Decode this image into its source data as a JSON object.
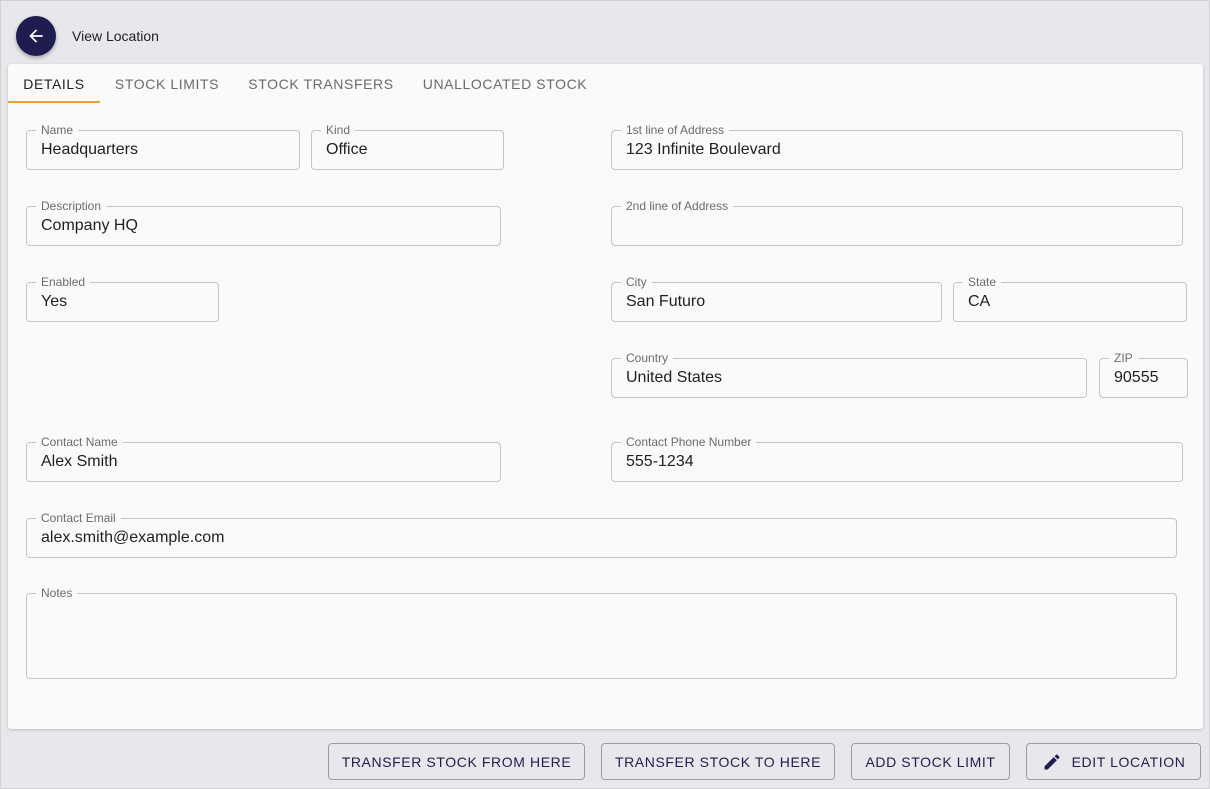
{
  "header": {
    "title": "View Location"
  },
  "tabs": [
    {
      "label": "Details",
      "active": true
    },
    {
      "label": "Stock Limits",
      "active": false
    },
    {
      "label": "Stock Transfers",
      "active": false
    },
    {
      "label": "Unallocated Stock",
      "active": false
    }
  ],
  "fields": {
    "name": {
      "label": "Name",
      "value": "Headquarters"
    },
    "kind": {
      "label": "Kind",
      "value": "Office"
    },
    "address1": {
      "label": "1st line of Address",
      "value": "123 Infinite Boulevard"
    },
    "description": {
      "label": "Description",
      "value": "Company HQ"
    },
    "address2": {
      "label": "2nd line of Address",
      "value": ""
    },
    "enabled": {
      "label": "Enabled",
      "value": "Yes"
    },
    "city": {
      "label": "City",
      "value": "San Futuro"
    },
    "state": {
      "label": "State",
      "value": "CA"
    },
    "country": {
      "label": "Country",
      "value": "United States"
    },
    "zip": {
      "label": "ZIP",
      "value": "90555"
    },
    "contact_name": {
      "label": "Contact Name",
      "value": "Alex Smith"
    },
    "contact_phone": {
      "label": "Contact Phone Number",
      "value": "555-1234"
    },
    "contact_email": {
      "label": "Contact Email",
      "value": "alex.smith@example.com"
    },
    "notes": {
      "label": "Notes",
      "value": ""
    }
  },
  "actions": {
    "transfer_from": "Transfer Stock From Here",
    "transfer_to": "Transfer Stock To Here",
    "add_limit": "Add Stock Limit",
    "edit": "Edit Location"
  },
  "colors": {
    "accent": "#f0a030",
    "primary": "#1f1d4f"
  },
  "icons": {
    "back": "arrow-left-icon",
    "edit": "pencil-icon"
  }
}
